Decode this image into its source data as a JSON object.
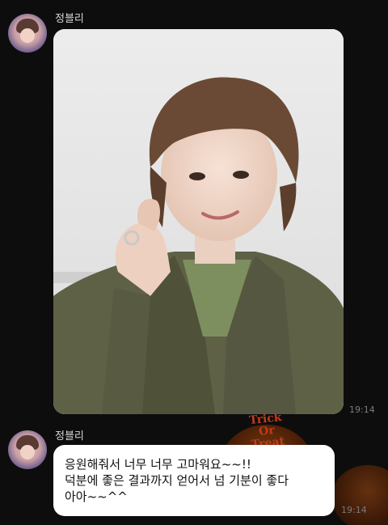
{
  "messages": [
    {
      "sender": "정블리",
      "type": "photo",
      "time": "19:14"
    },
    {
      "sender": "정블리",
      "type": "text",
      "lines": [
        "응원해줘서 너무 너무 고마워요~~!!",
        "덕분에 좋은 결과까지 얻어서 넘 기분이 좋다",
        "아아~~^^"
      ],
      "time": "19:14"
    }
  ],
  "background": {
    "decor_text": [
      "Trick",
      "Or",
      "Treat"
    ]
  },
  "colors": {
    "background": "#0d0d0d",
    "bubble": "#ffffff",
    "sender_name": "#d6d6d6",
    "timestamp": "#7a7a7a"
  }
}
